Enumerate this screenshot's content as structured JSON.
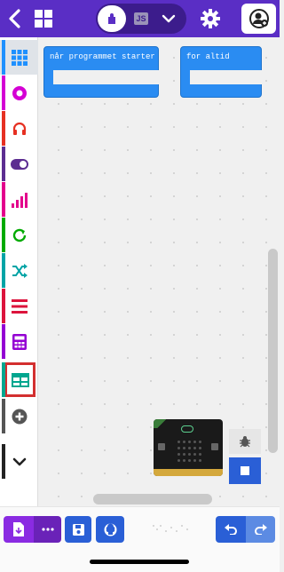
{
  "header": {
    "toggle_js_label": "JS"
  },
  "toolbox": {
    "categories": [
      {
        "name": "basic",
        "color": "#1e90ff"
      },
      {
        "name": "input",
        "color": "#d400d4"
      },
      {
        "name": "music",
        "color": "#e63022"
      },
      {
        "name": "led",
        "color": "#5c2d91"
      },
      {
        "name": "radio",
        "color": "#e3008c"
      },
      {
        "name": "loops",
        "color": "#00aa00"
      },
      {
        "name": "logic",
        "color": "#00a4a6"
      },
      {
        "name": "variables",
        "color": "#dc143c"
      },
      {
        "name": "math",
        "color": "#9400d3"
      },
      {
        "name": "extensions-table",
        "color": "#00a68f"
      },
      {
        "name": "add-extension",
        "color": "#555555"
      },
      {
        "name": "more",
        "color": "#222222"
      }
    ],
    "selected": "basic",
    "highlighted": "extensions-table"
  },
  "workspace": {
    "blocks": [
      {
        "label": "når programmet starter"
      },
      {
        "label": "for altid"
      }
    ]
  },
  "colors": {
    "header": "#5a2ec5",
    "block": "#2a8cf2",
    "accent": "#2a5fd6",
    "download": "#8a2be2"
  }
}
